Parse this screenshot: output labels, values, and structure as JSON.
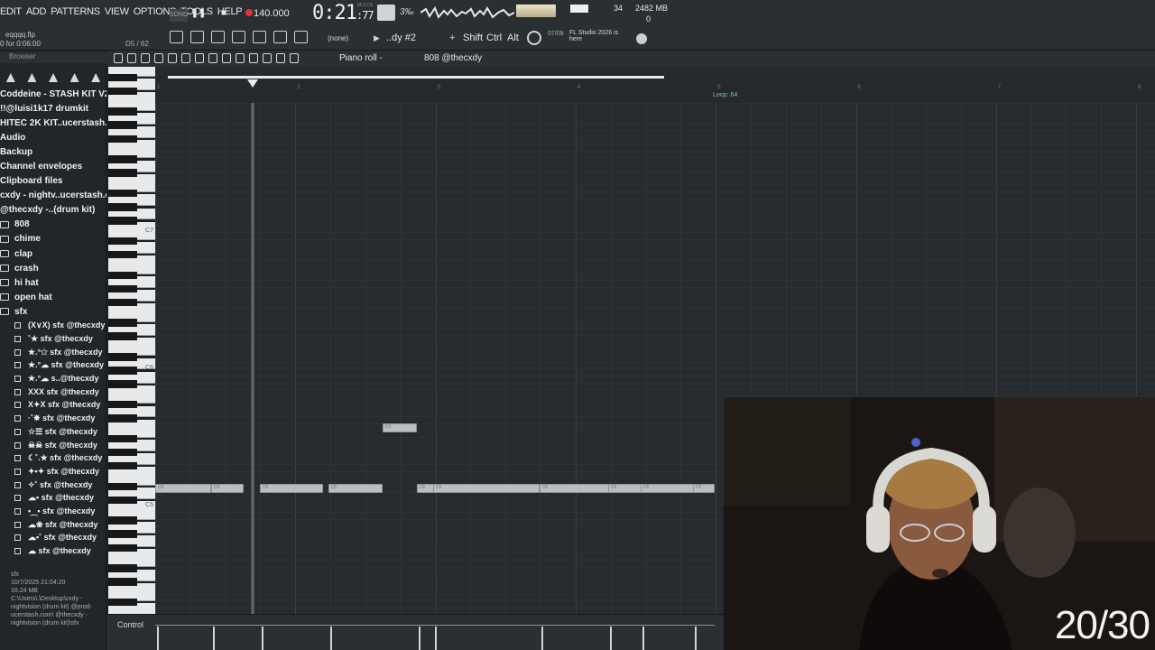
{
  "menu": [
    "EDIT",
    "ADD",
    "PATTERNS",
    "VIEW",
    "OPTIONS",
    "TOOLS",
    "HELP"
  ],
  "song_badge": "SONG",
  "tempo": "140.000",
  "timecode": {
    "main": "0:21",
    "sub": ":77",
    "label": "M:S:CS"
  },
  "cpu": "34",
  "memory": "2482 MB",
  "memory2": "0",
  "file": {
    "name": "eqqqq.flp",
    "hint": "0 for 0:06:00"
  },
  "note_readout": "D5 / 62",
  "none_label": "(none)",
  "pattern_name": "..dy #2",
  "keys": {
    "shift": "Shift",
    "ctrl": "Ctrl",
    "alt": "Alt"
  },
  "news": {
    "date": "07/09",
    "text1": "FL Studio 2026 is",
    "text2": "here"
  },
  "browser": {
    "title": "Browser",
    "items": [
      "Coddeine - STASH KIT V2 !",
      "!!@luisi1k17 drumkit",
      "HITEC 2K KIT..ucerstash.com",
      "Audio",
      "Backup",
      "Channel envelopes",
      "Clipboard files",
      "cxdy - nightv..ucerstash.com"
    ],
    "kit": "@thecxdy -..(drum kit)",
    "folders": [
      "808",
      "chime",
      "clap",
      "crash",
      "hi hat",
      "open hat",
      "sfx"
    ],
    "sfx": [
      "(X∨X) sfx @thecxdy",
      "˚★ sfx @thecxdy",
      "★.°✩ sfx @thecxdy",
      "★.°☁ sfx @thecxdy",
      "★.°☁ s..@thecxdy",
      "XXX sfx @thecxdy",
      "X✦X sfx @thecxdy",
      "·˚✵ sfx @thecxdy",
      "☆☰ sfx @thecxdy",
      "☠☠ sfx @thecxdy",
      "☾˚.★ sfx @thecxdy",
      "✦•✦ sfx @thecxdy",
      "✧˚ sfx @thecxdy",
      "☁• sfx @thecxdy",
      "•⁔• sfx @thecxdy",
      "☁❀ sfx @thecxdy",
      "☁•˚ sfx @thecxdy",
      "☁ sfx @thecxdy"
    ],
    "info": {
      "name": "sfx",
      "date": "10/7/2025 21:04:20",
      "size": "16.24 MB",
      "path": "C:\\Users\\.\\Desktop\\cxdy - nightvision (drum kit) @prod-ucerstash.com\\ @thecxdy - nightvision (drum kit)\\sfx"
    }
  },
  "piano_roll": {
    "title": "Piano roll - ",
    "channel": "808 @thecxdy",
    "loop_label": "Loop: 64",
    "bars": [
      "1",
      "2",
      "3",
      "4",
      "5",
      "6",
      "7",
      "8"
    ],
    "octaves": [
      "C7",
      "C6",
      "C5"
    ],
    "note_label": "D5",
    "control_label": "Control"
  },
  "stream_counter": "20/30"
}
